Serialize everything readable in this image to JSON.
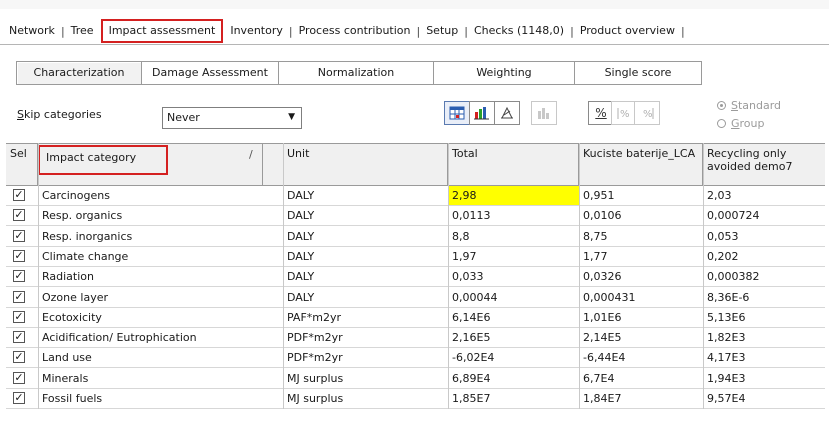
{
  "main_tabs": [
    {
      "label": "Network"
    },
    {
      "label": "Tree"
    },
    {
      "label": "Impact assessment",
      "active": true
    },
    {
      "label": "Inventory"
    },
    {
      "label": "Process contribution"
    },
    {
      "label": "Setup"
    },
    {
      "label": "Checks (1148,0)"
    },
    {
      "label": "Product overview"
    }
  ],
  "sub_tabs": [
    {
      "label": "Characterization",
      "active": true
    },
    {
      "label": "Damage Assessment"
    },
    {
      "label": "Normalization"
    },
    {
      "label": "Weighting"
    },
    {
      "label": "Single score"
    }
  ],
  "controls": {
    "skip_label_key": "S",
    "skip_label_rest": "kip categories",
    "skip_value": "Never",
    "percent_label": "%",
    "radio_standard_key": "S",
    "radio_standard_rest": "tandard",
    "radio_group_key": "G",
    "radio_group_rest": "roup"
  },
  "table": {
    "headers": {
      "sel": "Sel",
      "category": "Impact category",
      "unit": "Unit",
      "total": "Total",
      "col1": "Kuciste baterije_LCA",
      "col2": "Recycling only avoided demo7"
    },
    "rows": [
      {
        "category": "Carcinogens",
        "unit": "DALY",
        "total": "2,98",
        "col1": "0,951",
        "col2": "2,03"
      },
      {
        "category": "Resp. organics",
        "unit": "DALY",
        "total": "0,0113",
        "col1": "0,0106",
        "col2": "0,000724"
      },
      {
        "category": "Resp. inorganics",
        "unit": "DALY",
        "total": "8,8",
        "col1": "8,75",
        "col2": "0,053"
      },
      {
        "category": "Climate change",
        "unit": "DALY",
        "total": "1,97",
        "col1": "1,77",
        "col2": "0,202"
      },
      {
        "category": "Radiation",
        "unit": "DALY",
        "total": "0,033",
        "col1": "0,0326",
        "col2": "0,000382"
      },
      {
        "category": "Ozone layer",
        "unit": "DALY",
        "total": "0,00044",
        "col1": "0,000431",
        "col2": "8,36E-6"
      },
      {
        "category": "Ecotoxicity",
        "unit": "PAF*m2yr",
        "total": "6,14E6",
        "col1": "1,01E6",
        "col2": "5,13E6"
      },
      {
        "category": "Acidification/ Eutrophication",
        "unit": "PDF*m2yr",
        "total": "2,16E5",
        "col1": "2,14E5",
        "col2": "1,82E3"
      },
      {
        "category": "Land use",
        "unit": "PDF*m2yr",
        "total": "-6,02E4",
        "col1": "-6,44E4",
        "col2": "4,17E3"
      },
      {
        "category": "Minerals",
        "unit": "MJ surplus",
        "total": "6,89E4",
        "col1": "6,7E4",
        "col2": "1,94E3"
      },
      {
        "category": "Fossil fuels",
        "unit": "MJ surplus",
        "total": "1,85E7",
        "col1": "1,84E7",
        "col2": "9,57E4"
      }
    ]
  },
  "colors": {
    "highlight_cell": "#ffff00",
    "annotation_red": "#d42020"
  }
}
